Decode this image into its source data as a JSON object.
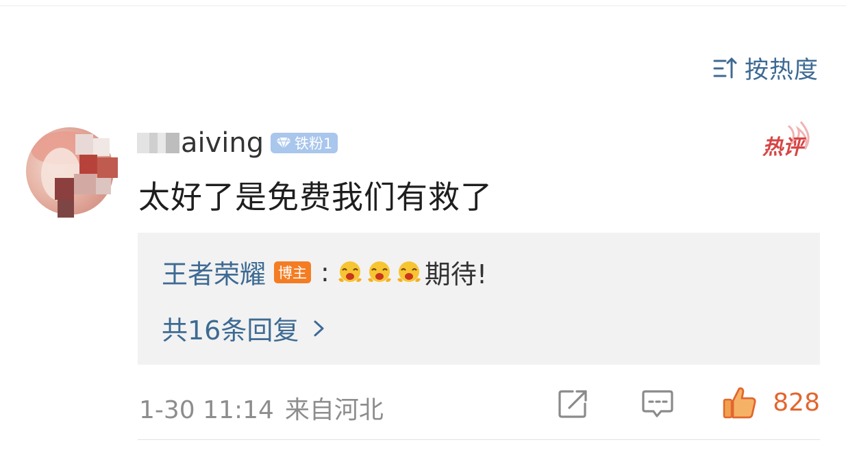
{
  "sort": {
    "label": "按热度",
    "icon": "sort-icon"
  },
  "comment": {
    "username_visible": "aiving",
    "fan_badge": "铁粉1",
    "hot_label": "热评",
    "text": "太好了是免费我们有救了"
  },
  "reply": {
    "author": "王者荣耀",
    "author_badge": "博主",
    "colon": ":",
    "text": "期待!",
    "emoji_count": 3,
    "more_label": "共16条回复"
  },
  "meta": {
    "date_time": "1-30 11:14",
    "location": "来自河北"
  },
  "actions": {
    "share_icon": "share-icon",
    "comment_icon": "comment-icon",
    "like_icon": "thumbs-up-icon",
    "like_count": "828"
  },
  "colors": {
    "link_blue": "#3d6a93",
    "like_orange": "#e2662e",
    "hot_red": "#d64545",
    "badge_orange": "#f47d23",
    "fan_badge_blue": "#a9c6ec"
  }
}
